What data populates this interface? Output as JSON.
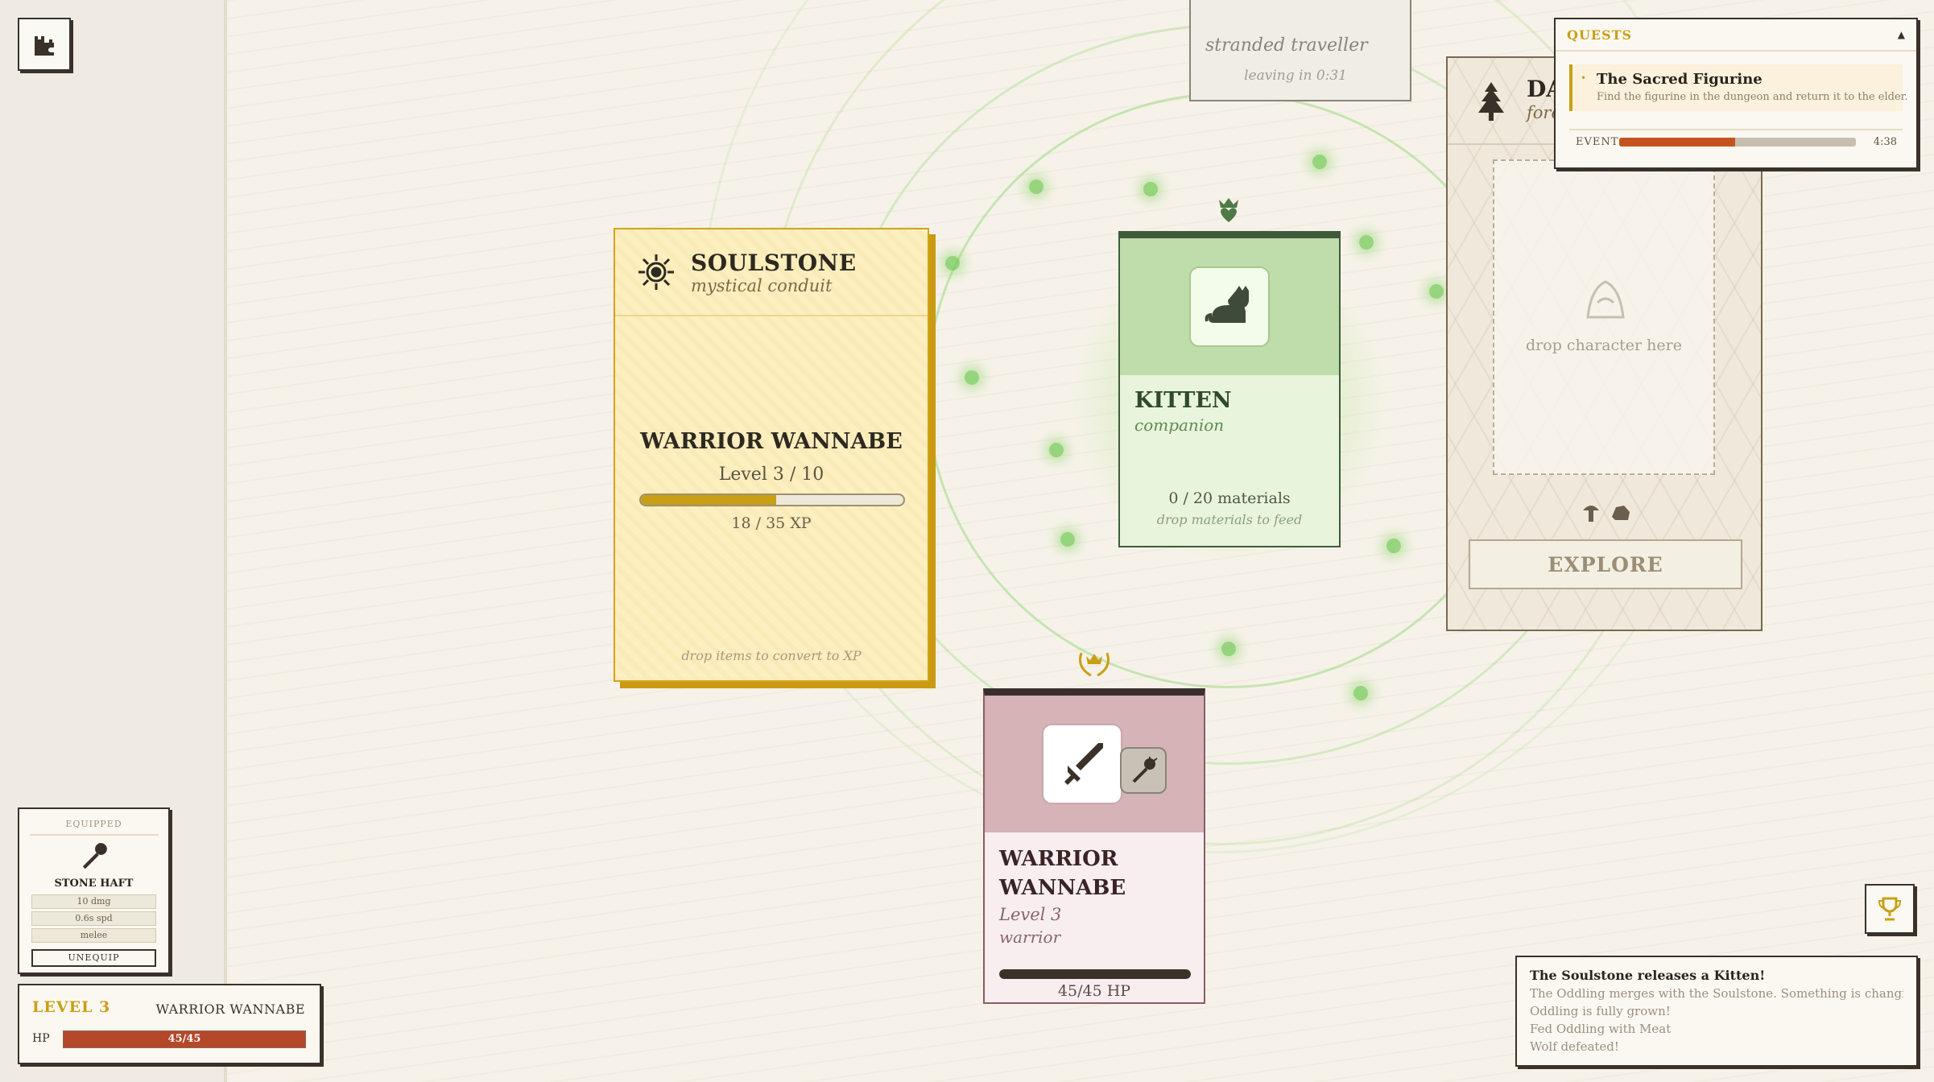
{
  "toolbar": {
    "top_left_icon": "castle-puzzle-icon",
    "achievements_icon": "trophy-icon"
  },
  "soulstone": {
    "title": "SOULSTONE",
    "subtitle": "mystical conduit",
    "character_name": "WARRIOR WANNABE",
    "level_text": "Level 3 / 10",
    "xp_text": "18 / 35 XP",
    "xp_progress": 0.514,
    "hint": "drop items to convert to XP",
    "icon": "sun-gear-icon"
  },
  "kitten": {
    "title": "KITTEN",
    "subtitle": "companion",
    "materials_text": "0 / 20 materials",
    "hint": "drop materials to feed",
    "icon": "cat-icon",
    "badge": "crown-heart-icon"
  },
  "warrior": {
    "title_line1": "WARRIOR",
    "title_line2": "WANNABE",
    "level": "Level 3",
    "class": "warrior",
    "hp_text": "45/45 HP",
    "hp_progress": 1.0,
    "icon": "sword-icon",
    "equip_icon": "mace-icon",
    "badge": "laurel-crown-icon"
  },
  "dark_forest": {
    "title_partial": "DA",
    "subtitle_partial": "fore",
    "drop_hint": "drop character here",
    "explore_label": "EXPLORE",
    "icon": "pine-tree-icon"
  },
  "traveller": {
    "subtitle": "stranded traveller",
    "timer": "leaving in 0:31"
  },
  "quests": {
    "header": "QUESTS",
    "collapse_icon": "caret-up-icon",
    "items": [
      {
        "title": "The Sacred Figurine",
        "desc": "Find the figurine in the dungeon and return it to the elder."
      }
    ],
    "event_label": "EVENT",
    "event_time": "4:38",
    "event_progress": 0.49
  },
  "equipped": {
    "label": "EQUIPPED",
    "item_name": "STONE HAFT",
    "stats": [
      "10 dmg",
      "0.6s spd",
      "melee"
    ],
    "unequip_label": "UNEQUIP",
    "icon": "mace-icon"
  },
  "status": {
    "level": "LEVEL 3",
    "name": "WARRIOR WANNABE",
    "hp_label": "HP",
    "hp_text": "45/45",
    "hp_progress": 1.0
  },
  "log": {
    "lines": [
      "The Soulstone releases a Kitten!",
      "The Oddling merges with the Soulstone. Something is changing...",
      "Oddling is fully grown!",
      "Fed Oddling with Meat",
      "Wolf defeated!"
    ]
  },
  "colors": {
    "soulstone_gold": "#d4a21c",
    "kitten_green": "#bfdcab",
    "warrior_rose": "#d5b3b6",
    "hp_red": "#b5472a",
    "event_orange": "#c4541f"
  }
}
